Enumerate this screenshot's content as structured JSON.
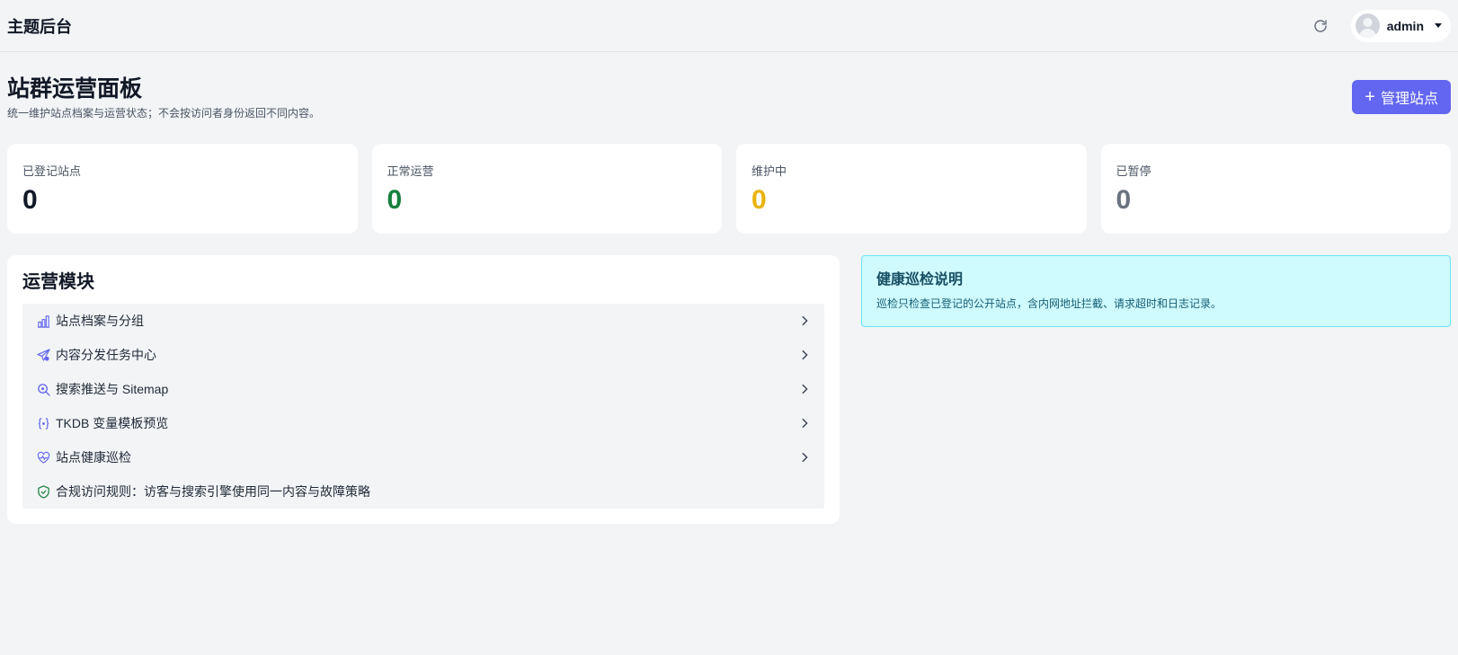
{
  "app": {
    "title": "主题后台"
  },
  "topbar": {
    "user_name": "admin"
  },
  "page": {
    "title": "站群运营面板",
    "subtitle": "统一维护站点档案与运营状态；不会按访问者身份返回不同内容。",
    "manage_button": "管理站点"
  },
  "stats": [
    {
      "label": "已登记站点",
      "value": "0",
      "color": "#111827"
    },
    {
      "label": "正常运营",
      "value": "0",
      "color": "#15803d"
    },
    {
      "label": "维护中",
      "value": "0",
      "color": "#eab308"
    },
    {
      "label": "已暂停",
      "value": "0",
      "color": "#6b7280"
    }
  ],
  "modules": {
    "title": "运营模块",
    "items": [
      {
        "label": "站点档案与分组",
        "icon": "building-chart-icon"
      },
      {
        "label": "内容分发任务中心",
        "icon": "send-plane-icon"
      },
      {
        "label": "搜索推送与 Sitemap",
        "icon": "search-zoom-icon"
      },
      {
        "label": "TKDB 变量模板预览",
        "icon": "code-braces-icon"
      },
      {
        "label": "站点健康巡检",
        "icon": "heart-pulse-icon"
      },
      {
        "label": "合规访问规则：访客与搜索引擎使用同一内容与故障策略",
        "icon": "shield-check-icon"
      }
    ]
  },
  "health": {
    "title": "健康巡检说明",
    "text": "巡检只检查已登记的公开站点，含内网地址拦截、请求超时和日志记录。"
  },
  "colors": {
    "accent": "#6366f1",
    "icon": "#6366f1",
    "shield": "#15803d"
  }
}
